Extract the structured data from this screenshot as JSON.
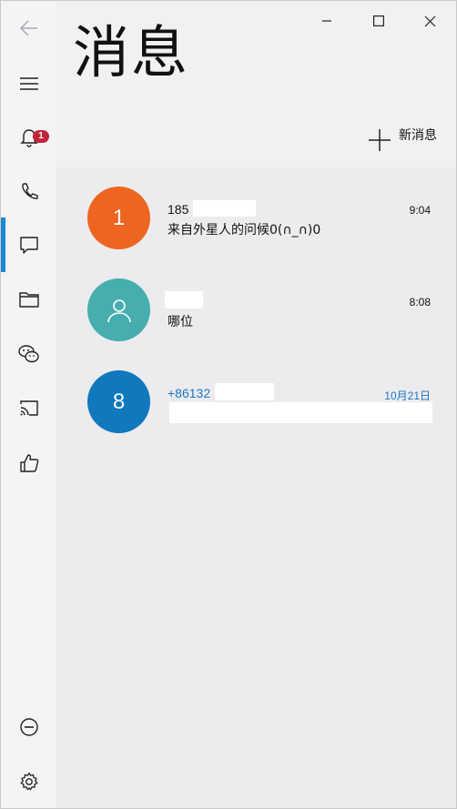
{
  "app": {
    "title": "消息",
    "back_icon": "back-arrow-icon",
    "window_controls": [
      "minimize-icon",
      "maximize-icon",
      "close-icon"
    ]
  },
  "rail": {
    "items": [
      {
        "name": "menu",
        "icon": "hamburger-icon"
      },
      {
        "name": "notifications",
        "icon": "bell-icon",
        "badge": "1"
      },
      {
        "name": "calls",
        "icon": "phone-icon"
      },
      {
        "name": "messages",
        "icon": "chat-bubble-icon",
        "active": true
      },
      {
        "name": "files",
        "icon": "folder-icon"
      },
      {
        "name": "wechat",
        "icon": "wechat-icon"
      },
      {
        "name": "cast",
        "icon": "cast-icon"
      },
      {
        "name": "feedback",
        "icon": "thumbs-up-icon"
      },
      {
        "name": "disconnect",
        "icon": "minus-circle-icon"
      },
      {
        "name": "settings",
        "icon": "gear-icon"
      }
    ],
    "accent": "#1f86d0",
    "badge_color": "#c4243a"
  },
  "toolbar": {
    "new_message_label": "新消息",
    "new_message_icon": "plus-icon"
  },
  "conversations": [
    {
      "avatar_text": "1",
      "avatar_color": "#ee6520",
      "name": "185",
      "time": "9:04",
      "preview": "来自外星人的问候0(∩_∩)0",
      "accent": false
    },
    {
      "avatar_text": "",
      "avatar_icon": "person-icon",
      "avatar_color": "#46aeae",
      "name": "",
      "time": "8:08",
      "preview": "哪位",
      "accent": false
    },
    {
      "avatar_text": "8",
      "avatar_color": "#1078bd",
      "name": "+86132",
      "time": "10月21日",
      "preview": "",
      "accent": true
    }
  ]
}
